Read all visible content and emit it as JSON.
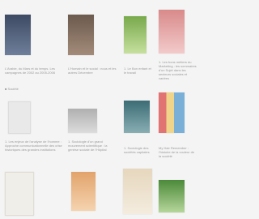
{
  "books": [
    {
      "caption": "L'Arabie, du Mars et du temps. Les campagnes de 2002 au 2005-2006",
      "cover": "c-dark"
    },
    {
      "caption": "L'Humain et le social : nous et les autres Décembre",
      "cover": "c-brown"
    },
    {
      "caption": "1. Le Bon enfant et le travail",
      "cover": "c-green"
    },
    {
      "caption": "1. Les bons métiers du Marketing : les sommaires d'un Sujet dans les secteurs sociales et variées",
      "cover": "c-red"
    },
    {
      "caption": "1. Les enjeux de l'analyse de l'homme : Approche communicationnelle des crise historiques des grandes institutions",
      "cover": "c-light"
    },
    {
      "caption": "1. Sociologie d'un grand mouvement scientifique : la genèse sociale de l'Hôpital",
      "cover": "c-grey"
    },
    {
      "caption": "1. Sociologie des sociétés capitales",
      "cover": "c-teal"
    },
    {
      "caption": "My Hair Remember : l'histoire de la couleur de la société",
      "cover": "c-multi"
    },
    {
      "caption": "",
      "cover": "c-pale"
    },
    {
      "caption": "",
      "cover": "c-orange"
    },
    {
      "caption": "",
      "cover": "c-beige"
    },
    {
      "caption": "",
      "cover": "c-green2"
    }
  ],
  "section_label": "■ Société"
}
